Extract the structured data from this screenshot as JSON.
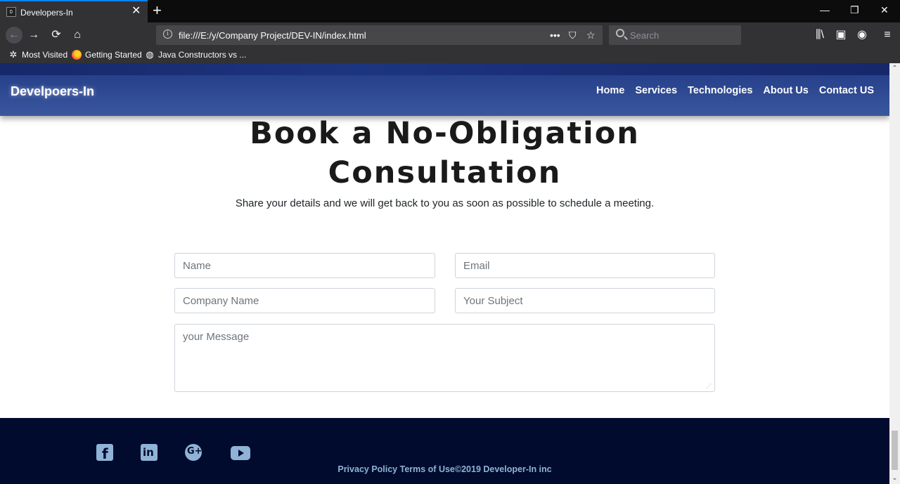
{
  "browser": {
    "tab_title": "Developers-In",
    "tab_close": "✕",
    "new_tab": "+",
    "window": {
      "minimize": "—",
      "restore": "❐",
      "close": "✕"
    },
    "nav": {
      "back": "←",
      "forward": "→",
      "reload": "⟳",
      "home": "⌂"
    },
    "url": "file:///E:/y/Company Project/DEV-IN/index.html",
    "url_actions": {
      "more": "•••",
      "pocket": "⛉",
      "bookmark": "☆"
    },
    "search_placeholder": "Search",
    "toolbar": {
      "library": "⫼\\",
      "sidebar": "▣",
      "account": "◉",
      "menu": "≡"
    },
    "bookmarks": [
      {
        "label": "Most Visited",
        "icon": "gear-icon"
      },
      {
        "label": "Getting Started",
        "icon": "firefox-icon"
      },
      {
        "label": "Java Constructors vs ...",
        "icon": "globe-icon"
      }
    ]
  },
  "site": {
    "brand": "Develpoers-In",
    "nav": [
      "Home",
      "Services",
      "Technologies",
      "About Us",
      "Contact US"
    ],
    "title_line1": "Book a No-Obligation",
    "title_line2": "Consultation",
    "subtitle": "Share your details and we will get back to you as soon as possible to schedule a meeting.",
    "form": {
      "name_placeholder": "Name",
      "email_placeholder": "Email",
      "company_placeholder": "Company Name",
      "subject_placeholder": "Your Subject",
      "message_placeholder": "your Message"
    },
    "footer": {
      "social": [
        "facebook-icon",
        "linkedin-icon",
        "google-plus-icon",
        "youtube-icon"
      ],
      "text": "Privacy Policy Terms of Use©2019 Developer-In inc"
    },
    "colors": {
      "header": "#2d4690",
      "footer": "#010b2e",
      "footer_text": "#8fb3d6"
    }
  }
}
